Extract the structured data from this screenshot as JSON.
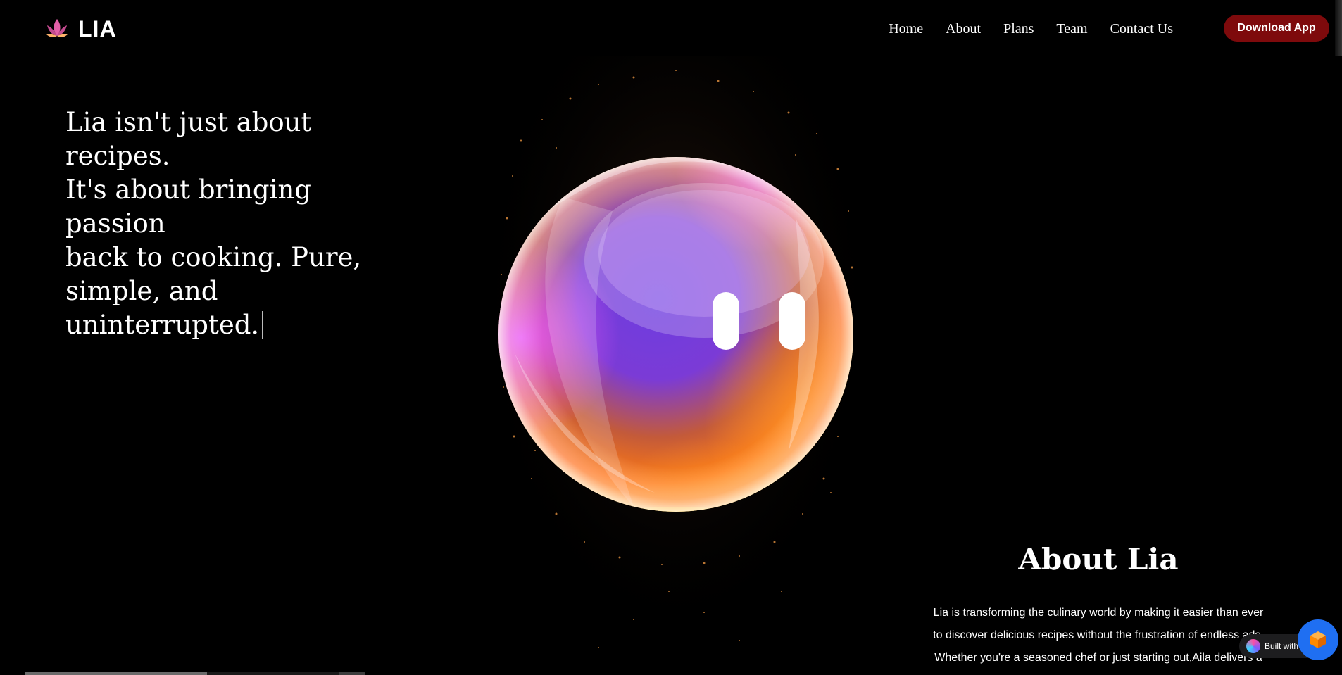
{
  "brand": {
    "name": "LIA",
    "logo_icon": "lotus-icon",
    "logo_colors": [
      "#e35fa7",
      "#ffb26b"
    ]
  },
  "nav": {
    "items": [
      {
        "label": "Home"
      },
      {
        "label": "About"
      },
      {
        "label": "Plans"
      },
      {
        "label": "Team"
      },
      {
        "label": "Contact Us"
      }
    ],
    "download_label": "Download App",
    "download_color": "#7e0a0c"
  },
  "hero": {
    "lines": [
      "Lia isn't just about recipes.",
      "It's about bringing passion",
      "back to cooking. Pure,",
      "simple, and uninterrupted."
    ]
  },
  "orb": {
    "icon": "glass-orb-mascot",
    "colors": [
      "#d64bff",
      "#7a3cf0",
      "#ff7a1a",
      "#ffd21a"
    ]
  },
  "about": {
    "title": "About Lia",
    "body": [
      "Lia is transforming the culinary world by making it easier than ever",
      "to discover delicious recipes without the frustration of endless ads.",
      "Whether you're a seasoned chef or just starting out,Aila delivers a"
    ]
  },
  "badge": {
    "text": "Built with",
    "icon": "builder-logo-icon",
    "fab_icon": "cube-icon",
    "fab_color": "#1f6ff2"
  }
}
